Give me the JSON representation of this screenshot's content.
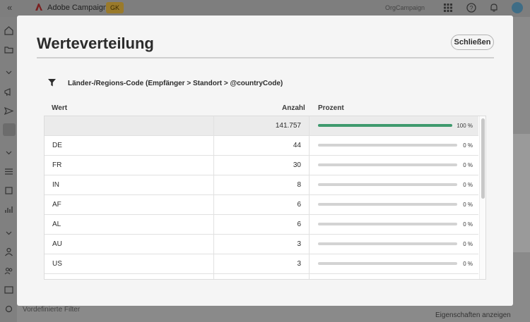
{
  "app": {
    "name": "Adobe Campaign",
    "badge": "GK",
    "org": "OrgCampaign",
    "bottom_left_text": "Vordefinierte Filter",
    "bottom_right_text": "Eigenschaften anzeigen"
  },
  "modal": {
    "title": "Werteverteilung",
    "close_label": "Schließen",
    "filter_label": "Länder-/Regions-Code (Empfänger > Standort > @countryCode)",
    "columns": {
      "wert": "Wert",
      "anzahl": "Anzahl",
      "prozent": "Prozent"
    },
    "rows": [
      {
        "wert": "",
        "anzahl": "141.757",
        "prozent": "100 %",
        "fraction": 1.0
      },
      {
        "wert": "DE",
        "anzahl": "44",
        "prozent": "0 %",
        "fraction": 0
      },
      {
        "wert": "FR",
        "anzahl": "30",
        "prozent": "0 %",
        "fraction": 0
      },
      {
        "wert": "IN",
        "anzahl": "8",
        "prozent": "0 %",
        "fraction": 0
      },
      {
        "wert": "AF",
        "anzahl": "6",
        "prozent": "0 %",
        "fraction": 0
      },
      {
        "wert": "AL",
        "anzahl": "6",
        "prozent": "0 %",
        "fraction": 0
      },
      {
        "wert": "AU",
        "anzahl": "3",
        "prozent": "0 %",
        "fraction": 0
      },
      {
        "wert": "US",
        "anzahl": "3",
        "prozent": "0 %",
        "fraction": 0
      },
      {
        "wert": "",
        "anzahl": "",
        "prozent": "",
        "fraction": 0
      }
    ]
  },
  "colors": {
    "bar_fill": "#3f9a6e",
    "bar_track": "#d3d3d3"
  },
  "icons": {
    "filter": "filter-icon",
    "collapse": "double-chevron-left-icon",
    "apps": "apps-grid-icon",
    "help": "help-icon",
    "bell": "bell-icon"
  }
}
